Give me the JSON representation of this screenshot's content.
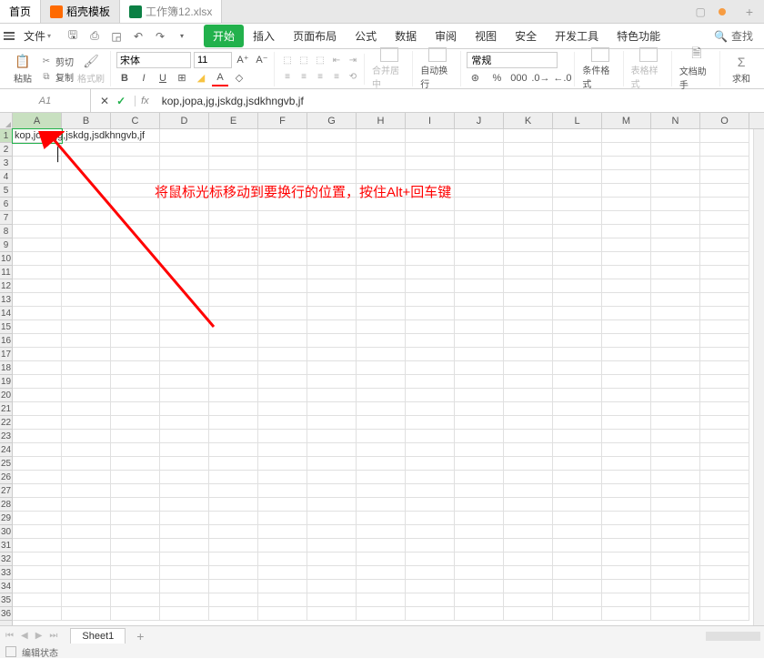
{
  "tabs": {
    "home": "首页",
    "template": "稻壳模板",
    "workbook": "工作簿12.xlsx"
  },
  "menus": {
    "file": "文件",
    "start": "开始",
    "insert": "插入",
    "page_layout": "页面布局",
    "formula": "公式",
    "data": "数据",
    "review": "审阅",
    "view": "视图",
    "security": "安全",
    "devtools": "开发工具",
    "feature": "特色功能",
    "search": "查找"
  },
  "ribbon": {
    "paste": "粘贴",
    "cut": "剪切",
    "copy": "复制",
    "format_painter": "格式刷",
    "font": "宋体",
    "font_size": "11",
    "merge_center": "合并居中",
    "wrap_text": "自动换行",
    "number_format": "常规",
    "conditional": "条件格式",
    "table_style": "表格样式",
    "doc_helper": "文档助手",
    "sum": "求和"
  },
  "formula_bar": {
    "cell_ref": "A1",
    "value": "kop,jopa,jg,jskdg,jsdkhngvb,jf"
  },
  "columns": [
    "A",
    "B",
    "C",
    "D",
    "E",
    "F",
    "G",
    "H",
    "I",
    "J",
    "K",
    "L",
    "M",
    "N",
    "O"
  ],
  "rows": [
    "1",
    "2",
    "3",
    "4",
    "5",
    "6",
    "7",
    "8",
    "9",
    "10",
    "11",
    "12",
    "13",
    "14",
    "15",
    "16",
    "17",
    "18",
    "19",
    "20",
    "21",
    "22",
    "23",
    "24",
    "25",
    "26",
    "27",
    "28",
    "29",
    "30",
    "31",
    "32",
    "33",
    "34",
    "35",
    "36"
  ],
  "cell_data": {
    "A1": "kop,jopa,jg,jskdg,jsdkhngvb,jf"
  },
  "annotation": "将鼠标光标移动到要换行的位置，按住Alt+回车键",
  "sheet": {
    "name": "Sheet1"
  },
  "status": {
    "edit": "编辑状态"
  }
}
